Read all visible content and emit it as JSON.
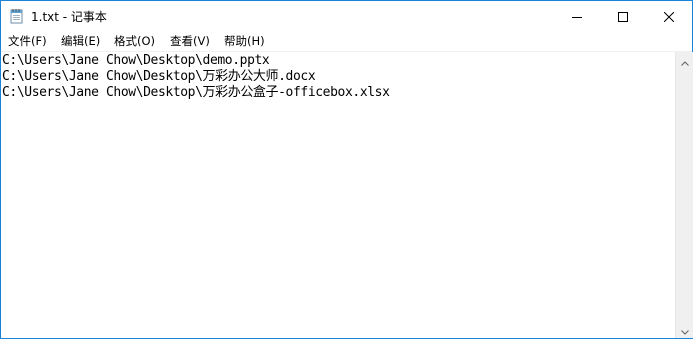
{
  "window": {
    "title": "1.txt - 记事本",
    "app_icon": "notepad-icon",
    "controls": {
      "minimize_icon": "minimize-icon",
      "maximize_icon": "maximize-icon",
      "close_icon": "close-icon"
    }
  },
  "menu": {
    "items": [
      {
        "label": "文件(F)"
      },
      {
        "label": "编辑(E)"
      },
      {
        "label": "格式(O)"
      },
      {
        "label": "查看(V)"
      },
      {
        "label": "帮助(H)"
      }
    ]
  },
  "editor": {
    "lines": [
      "C:\\Users\\Jane Chow\\Desktop\\demo.pptx",
      "C:\\Users\\Jane Chow\\Desktop\\万彩办公大师.docx",
      "C:\\Users\\Jane Chow\\Desktop\\万彩办公盒子-officebox.xlsx"
    ]
  },
  "scrollbar": {
    "up_icon": "scroll-up-arrow-icon",
    "down_icon": "scroll-down-arrow-icon"
  },
  "colors": {
    "window_border": "#1883d7",
    "scrollbar_track": "#f0f0f0",
    "text": "#000000"
  }
}
